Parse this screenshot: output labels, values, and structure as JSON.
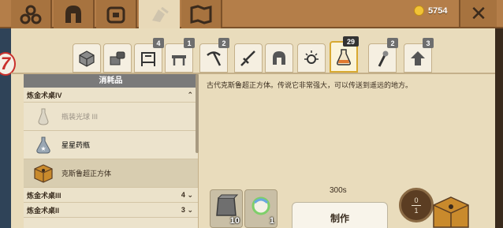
{
  "currency": {
    "amount": "5754",
    "coin_color": "#f2c335"
  },
  "top_tabs": [
    {
      "name": "resources",
      "icon": "resource-balls-icon"
    },
    {
      "name": "armor",
      "icon": "helmet-icon"
    },
    {
      "name": "inventory",
      "icon": "backpack-icon"
    },
    {
      "name": "crafting",
      "icon": "crafting-icon",
      "active": true
    },
    {
      "name": "map",
      "icon": "map-icon"
    }
  ],
  "close": {
    "label": "✕"
  },
  "side_badge": "7",
  "category_tabs": [
    {
      "icon": "cube-icon",
      "badge": ""
    },
    {
      "icon": "materials-icon",
      "badge": ""
    },
    {
      "icon": "furniture-icon",
      "badge": "4"
    },
    {
      "icon": "table-icon",
      "badge": "1"
    },
    {
      "icon": "pickaxe-icon",
      "badge": "2"
    },
    {
      "icon": "sword-icon",
      "badge": ""
    },
    {
      "icon": "helmet-icon",
      "badge": ""
    },
    {
      "icon": "sparkle-icon",
      "badge": ""
    },
    {
      "icon": "potion-flask-icon",
      "badge": "29",
      "active": true
    },
    {
      "icon": "torch-icon",
      "badge": "2"
    },
    {
      "icon": "upgrade-arrow-icon",
      "badge": "3"
    }
  ],
  "list": {
    "header": "消耗品",
    "groups": [
      {
        "label": "炼金术桌IV",
        "count": "",
        "arrow": "⌃"
      },
      {
        "label": "炼金术桌III",
        "count": "4",
        "arrow": "⌄"
      },
      {
        "label": "炼金术桌II",
        "count": "3",
        "arrow": "⌄"
      }
    ],
    "items": [
      {
        "label": "瓶装光球 III",
        "state": "disabled",
        "icon": "light-bottle-icon"
      },
      {
        "label": "星星药瓶",
        "state": "normal",
        "icon": "star-potion-icon"
      },
      {
        "label": "克斯鲁超正方体",
        "state": "selected",
        "icon": "tesseract-icon"
      }
    ]
  },
  "detail": {
    "description": "古代克斯鲁超正方体。传说它非常强大，可以传送到遥远的地方。",
    "materials": [
      {
        "icon": "stone-block-icon",
        "count": "10"
      },
      {
        "icon": "rainbow-orb-icon",
        "count": "1"
      }
    ],
    "craft_time": "300s",
    "craft_button": "制作",
    "queue_current": "0",
    "queue_total": "1",
    "result_icon": "tesseract-icon"
  }
}
